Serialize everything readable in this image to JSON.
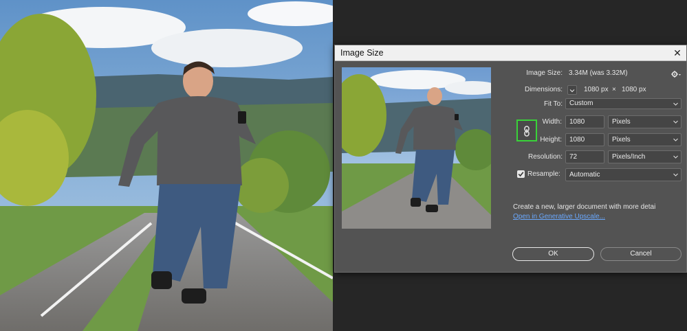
{
  "dialog": {
    "title": "Image Size",
    "close_glyph": "✕",
    "image_size_label": "Image Size:",
    "image_size_value": "3.34M (was 3.32M)",
    "dimensions_label": "Dimensions:",
    "dimensions_width": "1080 px",
    "dimensions_sep": "×",
    "dimensions_height": "1080 px",
    "fit_to_label": "Fit To:",
    "fit_to_value": "Custom",
    "width_label": "Width:",
    "width_value": "1080",
    "width_unit": "Pixels",
    "height_label": "Height:",
    "height_value": "1080",
    "height_unit": "Pixels",
    "resolution_label": "Resolution:",
    "resolution_value": "72",
    "resolution_unit": "Pixels/Inch",
    "resample_label": "Resample:",
    "resample_checked": true,
    "resample_value": "Automatic",
    "info_text": "Create a new, larger document with more detai",
    "upscale_link": "Open in Generative Upscale...",
    "ok_label": "OK",
    "cancel_label": "Cancel"
  },
  "icons": {
    "gear": "gear-icon",
    "link": "chain-link-icon",
    "chevron": "chevron-down-icon",
    "check": "checkmark-icon",
    "close": "close-icon"
  },
  "colors": {
    "dialog_bg": "#535353",
    "titlebar_bg": "#f0f0f0",
    "field_bg": "#454545",
    "link_toggle_highlight": "#39d339",
    "link_text": "#6aa9ff",
    "workspace_bg": "#262626"
  }
}
